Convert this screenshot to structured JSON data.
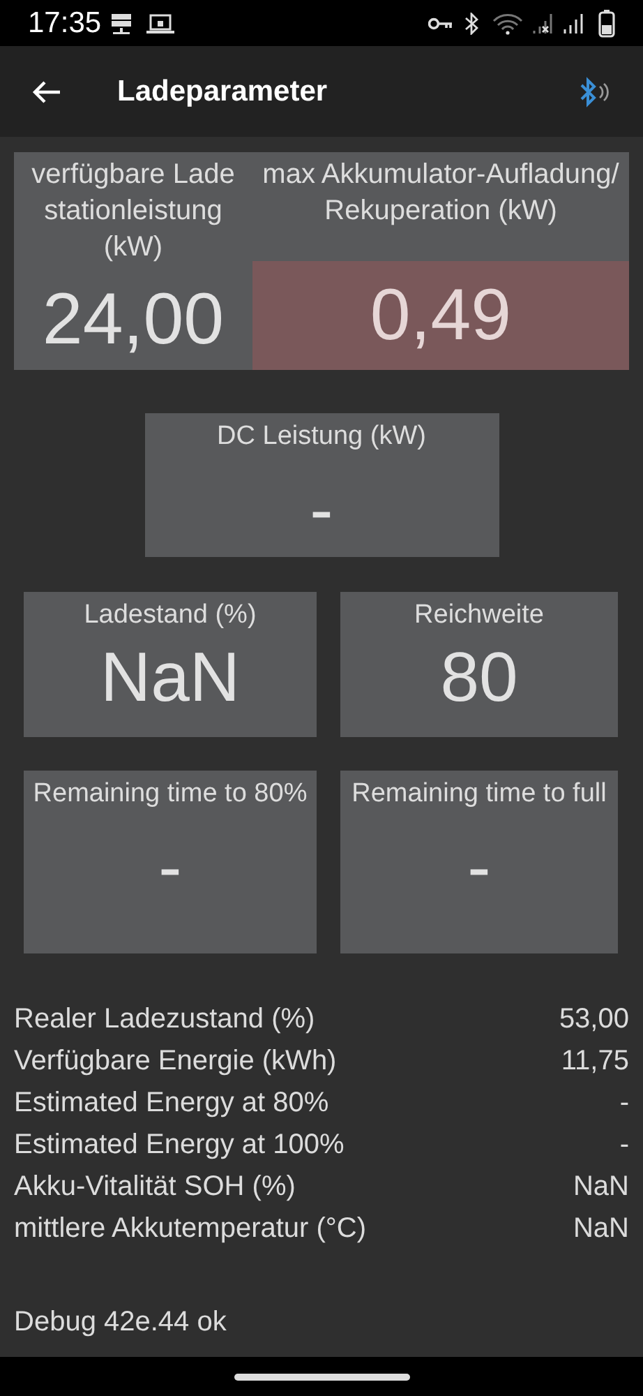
{
  "status_bar": {
    "time": "17:35"
  },
  "app_bar": {
    "title": "Ladeparameter"
  },
  "top_tiles": [
    {
      "title": "verfügbare Lade stationleistung (kW)",
      "value": "24,00",
      "alert": false
    },
    {
      "title": "max Akkumulator-Aufladung/ Rekuperation (kW)",
      "value": "0,49",
      "alert": true
    }
  ],
  "dc_tile": {
    "title": "DC Leistung (kW)",
    "value": "-"
  },
  "tiles": [
    {
      "title": "Ladestand (%)",
      "value": "NaN"
    },
    {
      "title": "Reichweite",
      "value": "80"
    },
    {
      "title": "Remaining time to 80%",
      "value": "-"
    },
    {
      "title": "Remaining time to full",
      "value": "-"
    }
  ],
  "rows": [
    {
      "label": "Realer Ladezustand (%)",
      "value": "53,00"
    },
    {
      "label": "Verfügbare Energie (kWh)",
      "value": "11,75"
    },
    {
      "label": "Estimated Energy at 80%",
      "value": "-"
    },
    {
      "label": "Estimated Energy at 100%",
      "value": "-"
    },
    {
      "label": "Akku-Vitalität SOH (%)",
      "value": "NaN"
    },
    {
      "label": "mittlere Akkutemperatur (°C)",
      "value": "NaN"
    }
  ],
  "debug": "Debug 42e.44 ok"
}
